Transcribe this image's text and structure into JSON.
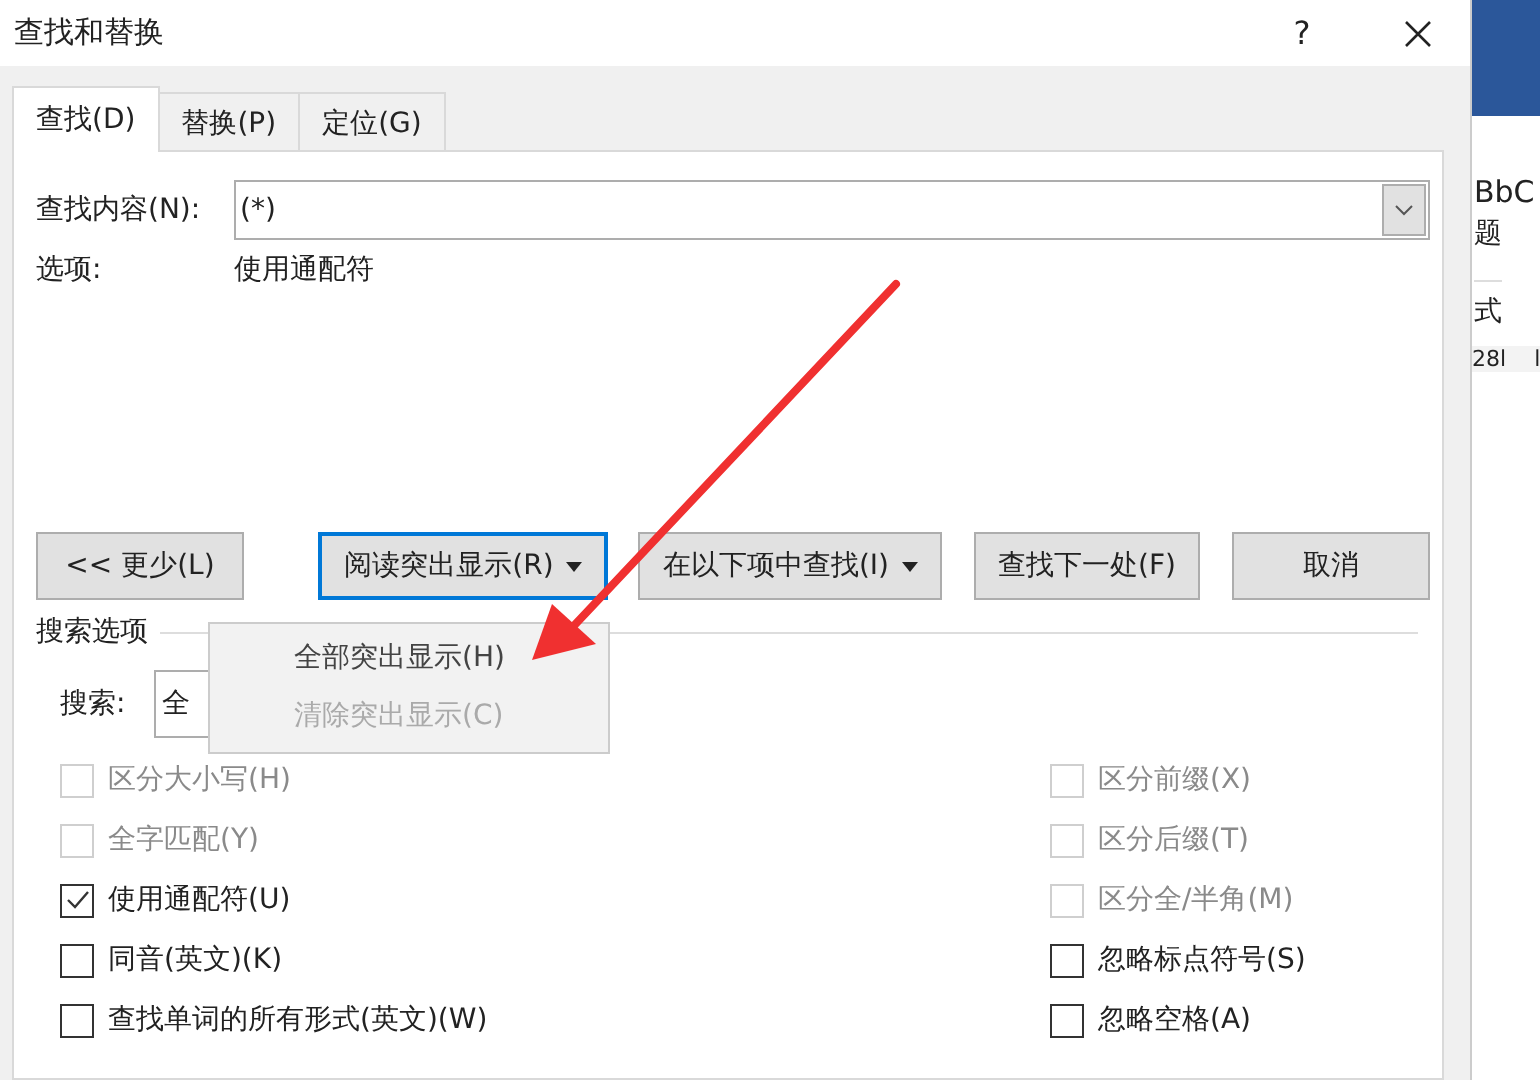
{
  "window": {
    "title": "查找和替换",
    "help": "?"
  },
  "tabs": [
    {
      "label": "查找(D)",
      "selected": true
    },
    {
      "label": "替换(P)",
      "selected": false
    },
    {
      "label": "定位(G)",
      "selected": false
    }
  ],
  "find_what": {
    "label": "查找内容(N):",
    "value": "(*)"
  },
  "options": {
    "label": "选项:",
    "value": "使用通配符"
  },
  "buttons": [
    {
      "label": "<< 更少(L)",
      "kind": "plain",
      "focused": false
    },
    {
      "label": "阅读突出显示(R)",
      "kind": "menu",
      "focused": true
    },
    {
      "label": "在以下项中查找(I)",
      "kind": "menu",
      "focused": false
    },
    {
      "label": "查找下一处(F)",
      "kind": "plain",
      "focused": false
    },
    {
      "label": "取消",
      "kind": "plain",
      "focused": false
    }
  ],
  "search_options": {
    "title": "搜索选项",
    "search_label": "搜索:",
    "search_value": "全"
  },
  "menu": [
    {
      "label": "全部突出显示(H)",
      "disabled": false
    },
    {
      "label": "清除突出显示(C)",
      "disabled": true
    }
  ],
  "checkboxes_left": [
    {
      "label": "区分大小写(H)",
      "checked": false,
      "disabled": true
    },
    {
      "label": "全字匹配(Y)",
      "checked": false,
      "disabled": true
    },
    {
      "label": "使用通配符(U)",
      "checked": true,
      "disabled": false
    },
    {
      "label": "同音(英文)(K)",
      "checked": false,
      "disabled": false
    },
    {
      "label": "查找单词的所有形式(英文)(W)",
      "checked": false,
      "disabled": false
    }
  ],
  "checkboxes_right": [
    {
      "label": "区分前缀(X)",
      "checked": false,
      "disabled": true
    },
    {
      "label": "区分后缀(T)",
      "checked": false,
      "disabled": true
    },
    {
      "label": "区分全/半角(M)",
      "checked": false,
      "disabled": true
    },
    {
      "label": "忽略标点符号(S)",
      "checked": false,
      "disabled": false
    },
    {
      "label": "忽略空格(A)",
      "checked": false,
      "disabled": false
    }
  ],
  "background_window": {
    "style_sample": "BbC",
    "style_name": "题",
    "group_label": "式",
    "ruler": [
      "28l",
      "l"
    ]
  }
}
